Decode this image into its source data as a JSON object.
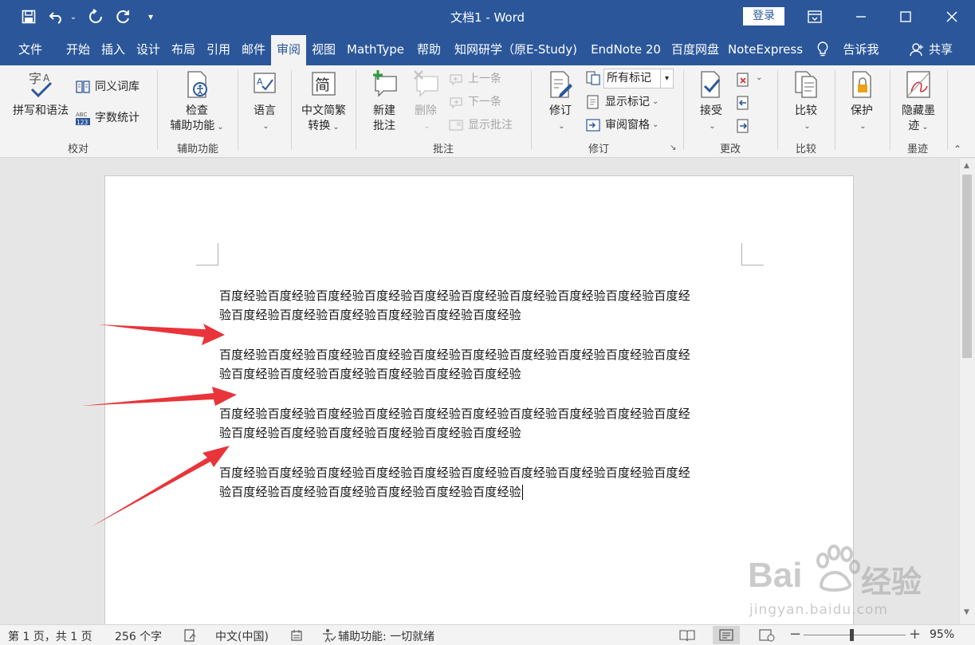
{
  "window": {
    "title": "文档1  -  Word",
    "login_label": "登录"
  },
  "tabs": [
    {
      "label": "文件"
    },
    {
      "label": "开始"
    },
    {
      "label": "插入"
    },
    {
      "label": "设计"
    },
    {
      "label": "布局"
    },
    {
      "label": "引用"
    },
    {
      "label": "邮件"
    },
    {
      "label": "审阅",
      "active": true
    },
    {
      "label": "视图"
    },
    {
      "label": "MathType"
    },
    {
      "label": "帮助"
    },
    {
      "label": "知网研学（原E-Study)"
    },
    {
      "label": "EndNote 20"
    },
    {
      "label": "百度网盘"
    },
    {
      "label": "NoteExpress"
    },
    {
      "label": "告诉我"
    },
    {
      "label": "共享"
    }
  ],
  "ribbon": {
    "proofing": {
      "label": "校对",
      "spelling": "拼写和语法",
      "thesaurus": "同义词库",
      "word_count": "字数统计"
    },
    "accessibility": {
      "label": "辅助功能",
      "check_line1": "检查",
      "check_line2": "辅助功能"
    },
    "language": {
      "label": "语言"
    },
    "chinese": {
      "convert_line1": "中文简繁",
      "convert_line2": "转换",
      "icon_glyph": "简"
    },
    "comments": {
      "label": "批注",
      "new_line1": "新建",
      "new_line2": "批注",
      "delete": "删除",
      "previous": "上一条",
      "next": "下一条",
      "show": "显示批注"
    },
    "tracking": {
      "label": "修订",
      "track": "修订",
      "markup_select": "所有标记",
      "show_markup": "显示标记",
      "review_pane": "审阅窗格"
    },
    "changes": {
      "label": "更改",
      "accept": "接受"
    },
    "compare": {
      "label": "比较",
      "compare": "比较"
    },
    "protect": {
      "protect": "保护"
    },
    "ink": {
      "label": "墨迹",
      "hide_line1": "隐藏墨",
      "hide_line2": "迹"
    }
  },
  "document": {
    "paragraphs": [
      {
        "line1": "百度经验百度经验百度经验百度经验百度经验百度经验百度经验百度经验百度经验百度经",
        "line2": "验百度经验百度经验百度经验百度经验百度经验百度经验"
      },
      {
        "line1": "百度经验百度经验百度经验百度经验百度经验百度经验百度经验百度经验百度经验百度经",
        "line2": "验百度经验百度经验百度经验百度经验百度经验百度经验"
      },
      {
        "line1": "百度经验百度经验百度经验百度经验百度经验百度经验百度经验百度经验百度经验百度经",
        "line2": "验百度经验百度经验百度经验百度经验百度经验百度经验"
      },
      {
        "line1": "百度经验百度经验百度经验百度经验百度经验百度经验百度经验百度经验百度经验百度经",
        "line2": "验百度经验百度经验百度经验百度经验百度经验百度经验"
      }
    ],
    "annotation_color": "#e8343a"
  },
  "status": {
    "page": "第 1 页，共 1 页",
    "words": "256 个字",
    "language": "中文(中国)",
    "accessibility": "辅助功能: 一切就绪",
    "zoom": "95%"
  },
  "watermark": {
    "brand_left": "Bai",
    "brand_right": "经验",
    "url": "jingyan.baidu.com"
  },
  "colors": {
    "accent": "#2b579a",
    "ribbon_bg": "#f3f3f3"
  }
}
